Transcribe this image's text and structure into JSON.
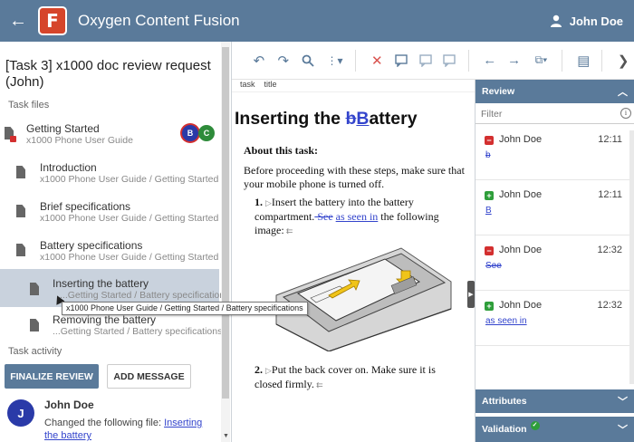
{
  "app": {
    "title": "Oxygen Content Fusion",
    "logo_letter": "F",
    "user_name": "John Doe"
  },
  "task": {
    "title": "[Task 3] x1000 doc review request (John)",
    "files_label": "Task files",
    "activity_label": "Task activity"
  },
  "files": [
    {
      "title": "Getting Started",
      "path": "x1000 Phone User Guide",
      "avatars": [
        "B",
        "C"
      ]
    },
    {
      "title": "Introduction",
      "path": "x1000 Phone User Guide / Getting Started"
    },
    {
      "title": "Brief specifications",
      "path": "x1000 Phone User Guide / Getting Started"
    },
    {
      "title": "Battery specifications",
      "path": "x1000 Phone User Guide / Getting Started"
    },
    {
      "title": "Inserting the battery",
      "path": "...Getting Started / Battery specifications"
    },
    {
      "title": "Removing the battery",
      "path": "...Getting Started / Battery specifications"
    }
  ],
  "tooltip": "x1000 Phone User Guide / Getting Started / Battery specifications",
  "actions": {
    "finalize": "FINALIZE REVIEW",
    "add_message": "ADD MESSAGE"
  },
  "activity": {
    "avatar": "J",
    "author": "John Doe",
    "text": "Changed the following file: ",
    "link": "Inserting the battery"
  },
  "breadcrumb": [
    "task",
    "title"
  ],
  "doc": {
    "title_prefix": "Inserting the ",
    "title_deleted": "b",
    "title_inserted": "B",
    "title_suffix": "attery",
    "about": "About this task:",
    "intro": "Before proceeding with these steps, make sure that your mobile phone is turned off.",
    "step1_num": "1.",
    "step1_a": "Insert the battery into the battery compartment.",
    "step1_deleted": " See",
    "step1_inserted": "as seen in",
    "step1_b": " the following image:",
    "step2_num": "2.",
    "step2": "Put the back cover on. Make sure it is closed firmly."
  },
  "review": {
    "header": "Review",
    "filter_placeholder": "Filter",
    "items": [
      {
        "type": "delete",
        "author": "John Doe",
        "time": "12:11",
        "text": "b"
      },
      {
        "type": "insert",
        "author": "John Doe",
        "time": "12:11",
        "text": "B"
      },
      {
        "type": "delete",
        "author": "John Doe",
        "time": "12:32",
        "text": " See"
      },
      {
        "type": "insert",
        "author": "John Doe",
        "time": "12:32",
        "text": "as seen in"
      }
    ],
    "attributes_header": "Attributes",
    "validation_header": "Validation"
  },
  "colors": {
    "primary": "#5a7a9a",
    "logo": "#d6452b",
    "change": "#3344cc",
    "delete_badge": "#d32f2f",
    "insert_badge": "#2e9e3a"
  }
}
